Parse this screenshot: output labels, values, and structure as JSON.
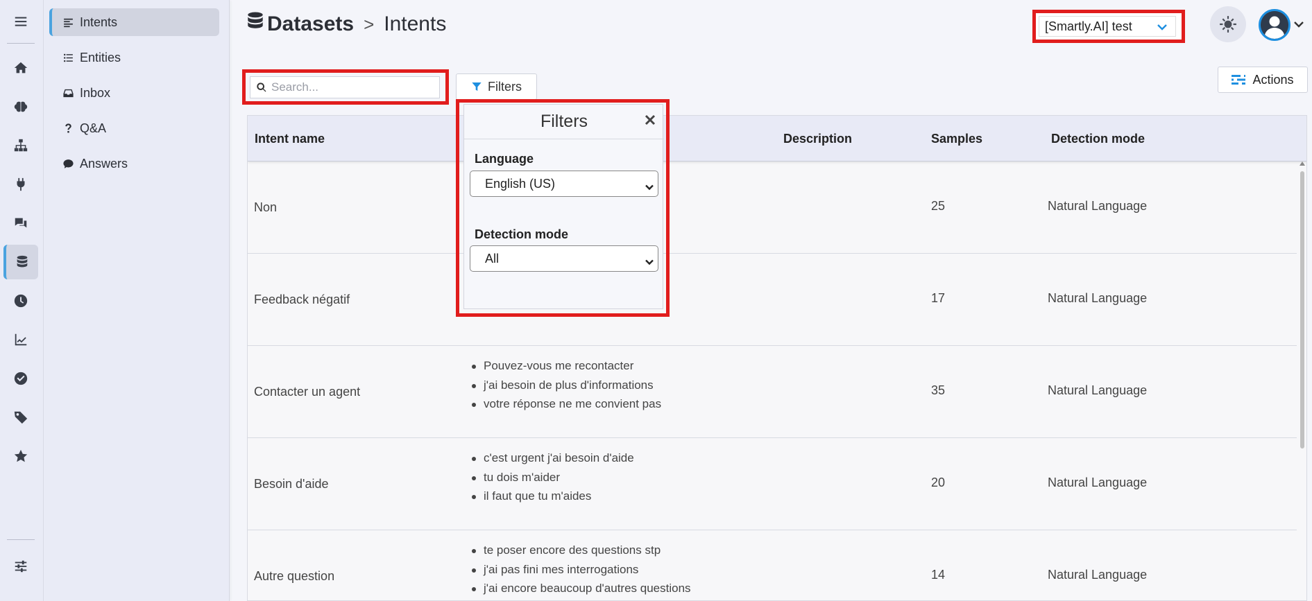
{
  "breadcrumb": {
    "section": "Datasets",
    "separator": ">",
    "page": "Intents"
  },
  "project_selector": {
    "value": "[Smartly.AI] test"
  },
  "subnav": {
    "items": [
      {
        "label": "Intents",
        "icon": "align-left-icon",
        "active": true
      },
      {
        "label": "Entities",
        "icon": "list-icon",
        "active": false
      },
      {
        "label": "Inbox",
        "icon": "inbox-icon",
        "active": false
      },
      {
        "label": "Q&A",
        "icon": "question-icon",
        "active": false
      },
      {
        "label": "Answers",
        "icon": "comment-icon",
        "active": false
      }
    ]
  },
  "rail": {
    "icons": [
      "menu-icon",
      "home-icon",
      "brain-icon",
      "sitemap-icon",
      "plug-icon",
      "chat-icon",
      "database-icon",
      "clock-icon",
      "chart-line-icon",
      "check-circle-icon",
      "tag-icon",
      "star-icon",
      "sliders-icon"
    ]
  },
  "search": {
    "placeholder": "Search..."
  },
  "filters_button": {
    "label": "Filters"
  },
  "actions_button": {
    "label": "Actions"
  },
  "filters_popover": {
    "title": "Filters",
    "language_label": "Language",
    "language_value": "English (US)",
    "detection_label": "Detection mode",
    "detection_value": "All"
  },
  "table": {
    "columns": {
      "intent": "Intent name",
      "description": "Description",
      "samples": "Samples",
      "detection": "Detection mode"
    },
    "rows": [
      {
        "name": "Non",
        "samples_list": [],
        "samples": "25",
        "detection": "Natural Language"
      },
      {
        "name": "Feedback négatif",
        "samples_list": [],
        "samples": "17",
        "detection": "Natural Language"
      },
      {
        "name": "Contacter un agent",
        "samples_list": [
          "Pouvez-vous me recontacter",
          "j'ai besoin de plus d'informations",
          "votre réponse ne me convient pas"
        ],
        "samples": "35",
        "detection": "Natural Language"
      },
      {
        "name": "Besoin d'aide",
        "samples_list": [
          "c'est urgent j'ai besoin d'aide",
          "tu dois m'aider",
          "il faut que tu m'aides"
        ],
        "samples": "20",
        "detection": "Natural Language"
      },
      {
        "name": "Autre question",
        "samples_list": [
          "te poser encore des questions stp",
          "j'ai pas fini mes interrogations",
          "j'ai encore beaucoup d'autres questions"
        ],
        "samples": "14",
        "detection": "Natural Language"
      }
    ]
  },
  "colors": {
    "accent": "#1e8fe0",
    "highlight": "#e11d1d",
    "sidebar_bg": "#e9ebf6"
  }
}
